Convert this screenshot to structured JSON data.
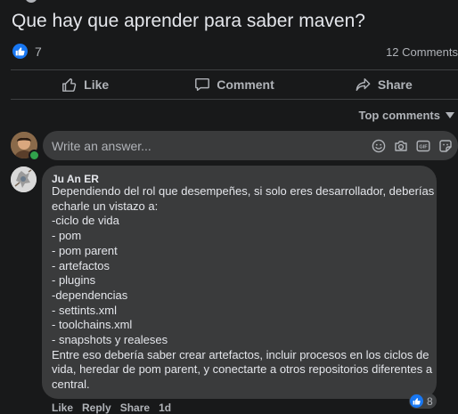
{
  "post": {
    "title": "Que hay que aprender para saber maven?",
    "reaction_count": "7",
    "comments_count": "12 Comments"
  },
  "actions": {
    "like": "Like",
    "comment": "Comment",
    "share": "Share"
  },
  "sort": {
    "label": "Top comments"
  },
  "answer_box": {
    "placeholder": "Write an answer...",
    "icons": [
      "emoji-icon",
      "camera-icon",
      "gif-icon",
      "sticker-icon"
    ]
  },
  "comment": {
    "author": "Ju An ER",
    "lines": [
      "Dependiendo del rol que desempeñes, si solo eres desarrollador, deberías",
      "echarle un vistazo a:",
      "-ciclo de vida",
      "- pom",
      "- pom parent",
      "- artefactos",
      "- plugins",
      "-dependencias",
      "- settints.xml",
      "- toolchains.xml",
      "- snapshots y realeses",
      "Entre eso debería saber crear artefactos, incluir procesos en los ciclos de",
      "vida, heredar de pom parent, y conectarte a otros repositorios diferentes a",
      "central."
    ],
    "reaction_count": "8",
    "action_like": "Like",
    "action_reply": "Reply",
    "action_share": "Share",
    "timestamp": "1d"
  },
  "colors": {
    "background": "#18191a",
    "bubble": "#3a3b3c",
    "text_primary": "#e4e6eb",
    "text_secondary": "#b0b3b8",
    "like_blue": "#1877f2",
    "online_green": "#31a24c"
  }
}
